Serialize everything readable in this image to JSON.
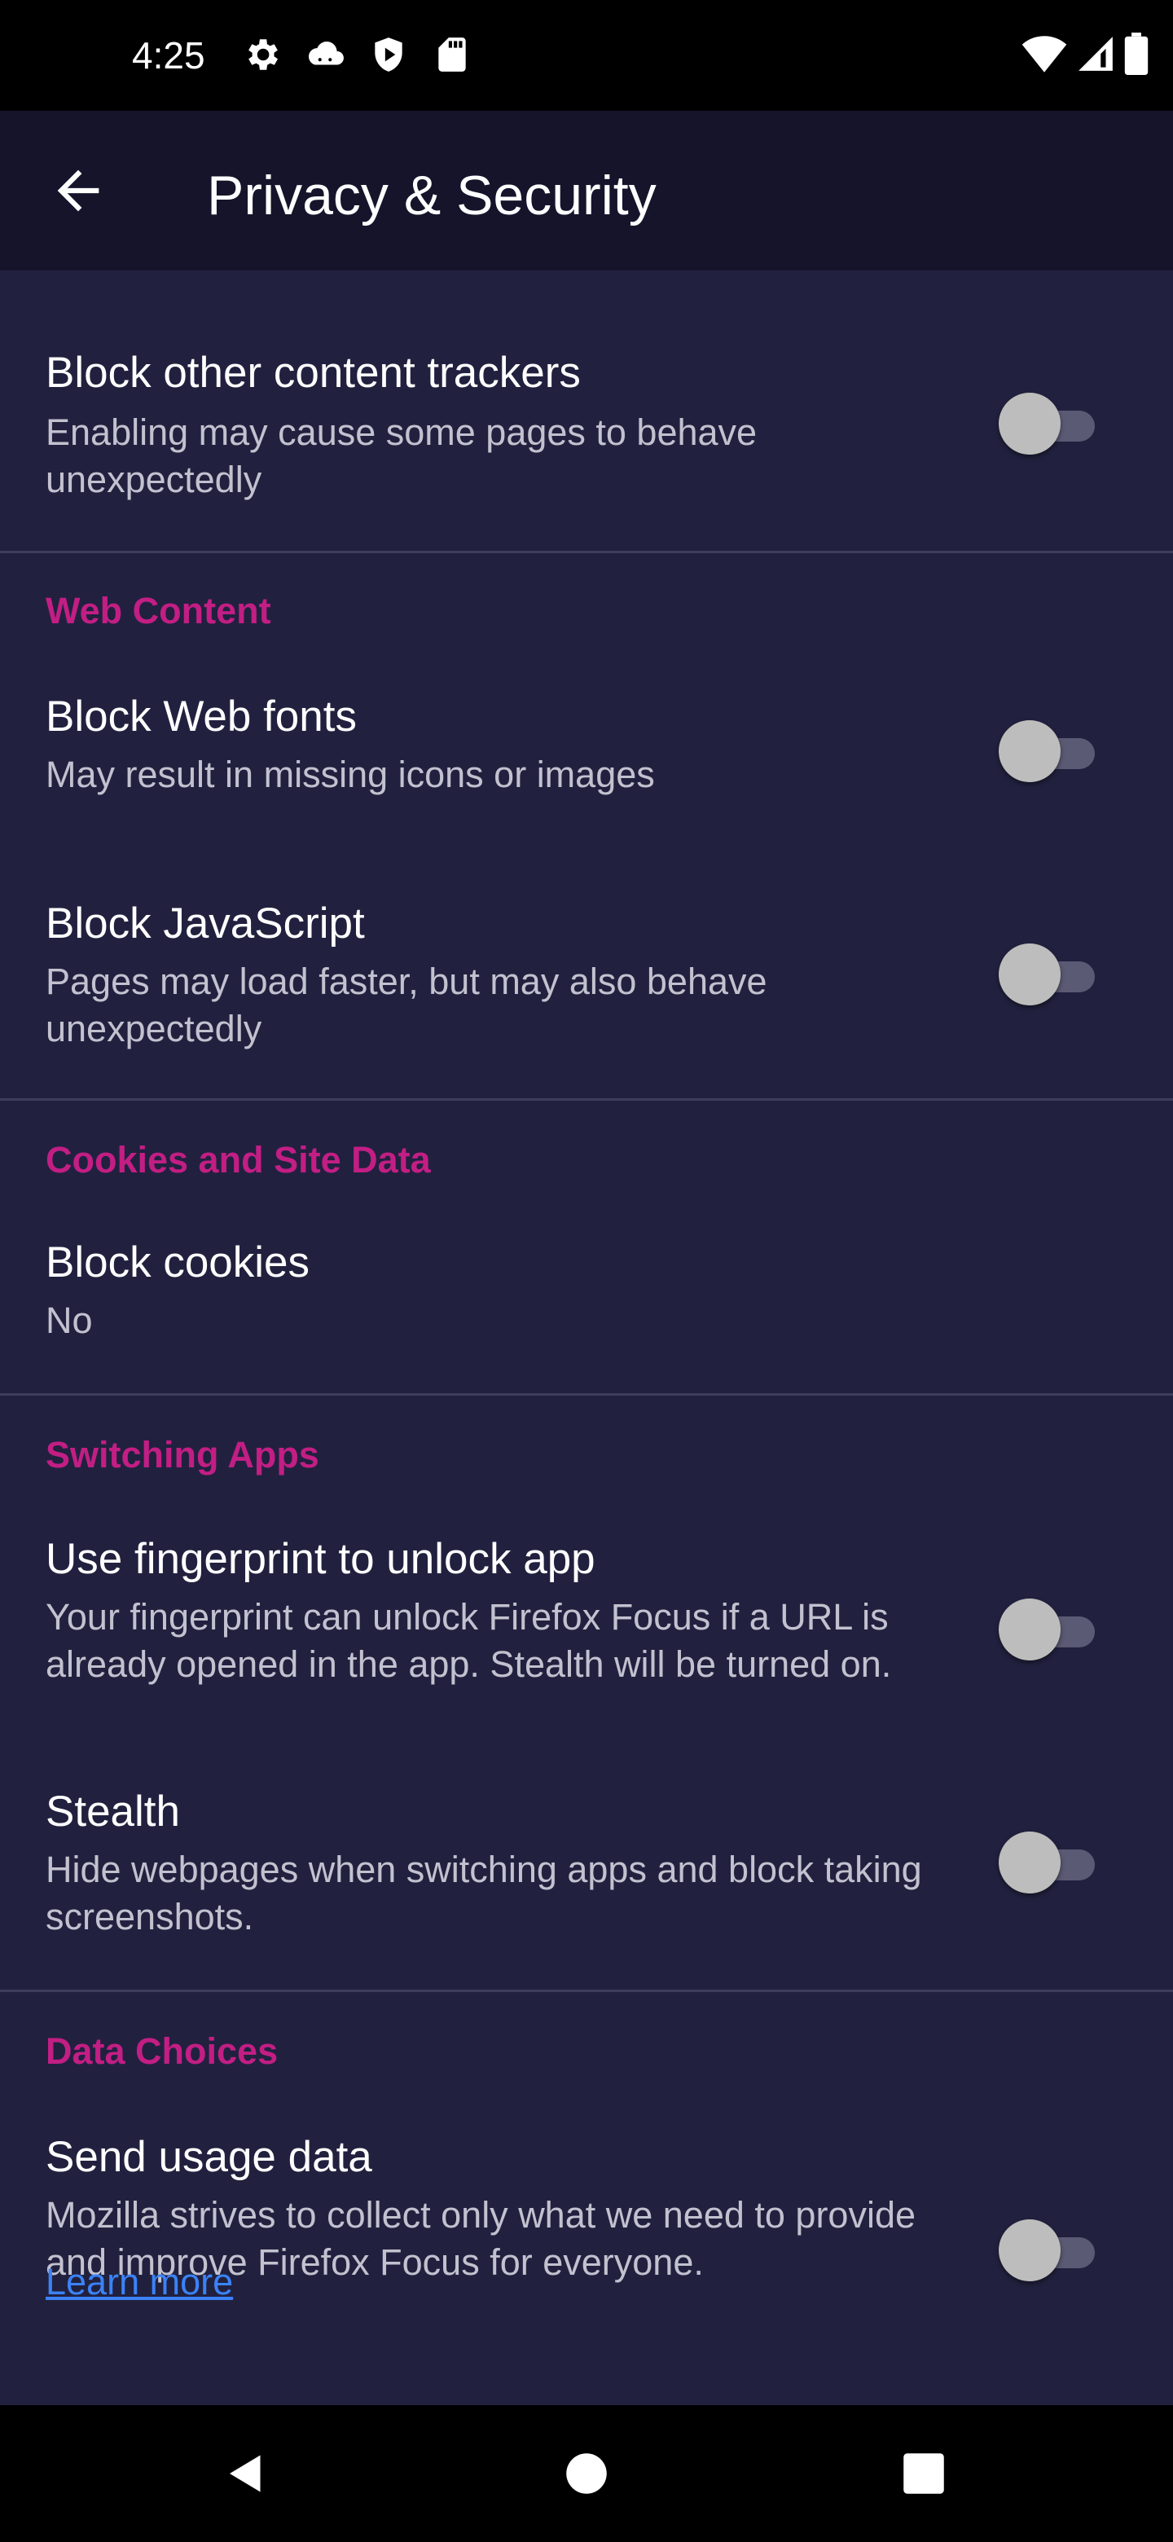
{
  "status_bar": {
    "time": "4:25",
    "left_icons": [
      "gear-icon",
      "cloud-icon",
      "shield-play-icon",
      "sd-card-icon"
    ],
    "right_icons": [
      "wifi-icon",
      "signal-icon",
      "battery-icon"
    ]
  },
  "app_bar": {
    "back_icon": "arrow-back-icon",
    "title": "Privacy & Security"
  },
  "prefs": {
    "block_other_trackers": {
      "title": "Block other content trackers",
      "summary": "Enabling may cause some pages to behave unexpectedly",
      "enabled": false
    },
    "web_content_category": "Web Content",
    "block_web_fonts": {
      "title": "Block Web fonts",
      "summary": "May result in missing icons or images",
      "enabled": false
    },
    "block_javascript": {
      "title": "Block JavaScript",
      "summary": "Pages may load faster, but may also behave unexpectedly",
      "enabled": false
    },
    "cookies_category": "Cookies and Site Data",
    "block_cookies": {
      "title": "Block cookies",
      "value": "No"
    },
    "switching_apps_category": "Switching Apps",
    "fingerprint_unlock": {
      "title": "Use fingerprint to unlock app",
      "summary": "Your fingerprint can unlock Firefox Focus if a URL is already opened in the app. Stealth will be turned on.",
      "enabled": false
    },
    "stealth": {
      "title": "Stealth",
      "summary": "Hide webpages when switching apps and block taking screenshots.",
      "enabled": false
    },
    "data_choices_category": "Data Choices",
    "send_usage_data": {
      "title": "Send usage data",
      "summary": "Mozilla strives to collect only what we need to provide and improve Firefox Focus for everyone.",
      "link": "Learn more",
      "enabled": false
    }
  },
  "colors": {
    "background": "#21213f",
    "app_bar": "#15142b",
    "category": "#c21e84",
    "link": "#3b82f6"
  },
  "nav_bar": {
    "icons": [
      "back-triangle-icon",
      "home-circle-icon",
      "recents-square-icon"
    ]
  }
}
